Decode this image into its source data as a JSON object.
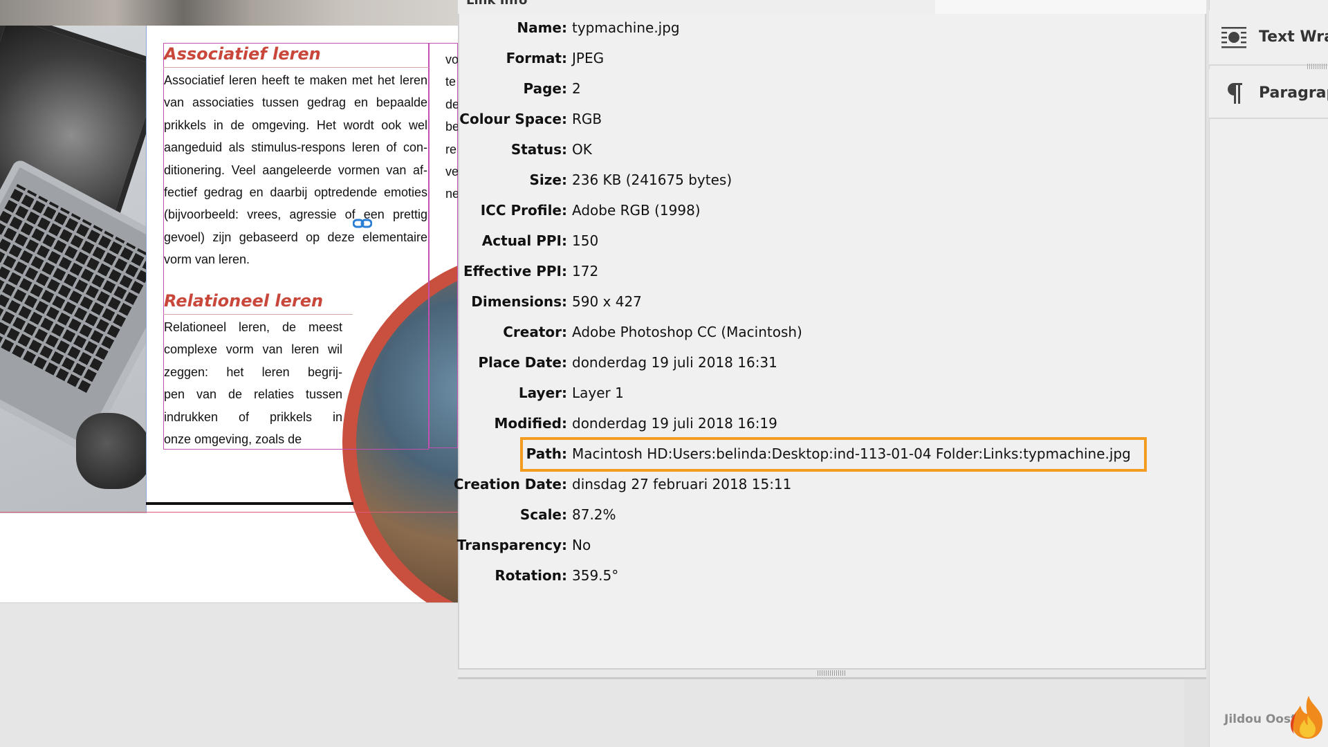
{
  "document": {
    "heading1": "Associatief leren",
    "para1_lines": [
      "Associatief leren heeft te maken met het leren",
      "van associaties tussen gedrag en bepaalde",
      "prikkels in de omgeving. Het wordt ook wel",
      "aangeduid als stimulus-respons leren of con-",
      "ditionering. Veel aangeleerde vormen van af-",
      "fectief gedrag en daarbij optredende emoties",
      "(bijvoorbeeld: vrees, agressie of een prettig",
      "gevoel) zijn gebaseerd op deze elementaire",
      "vorm van leren."
    ],
    "heading2": "Relationeel leren",
    "para2_lines": [
      "Relationeel leren, de meest",
      "complexe vorm van leren wil",
      "zeggen: het leren begrij-",
      "pen van de relaties tussen",
      "indrukken of prikkels in",
      "onze omgeving, zoals de"
    ],
    "col2_fragments": [
      "vo",
      "te",
      "de",
      "be",
      "re",
      "ve",
      "ne"
    ]
  },
  "link_info": {
    "title": "Link Info",
    "rows": [
      {
        "label": "Name:",
        "value": "typmachine.jpg"
      },
      {
        "label": "Format:",
        "value": "JPEG"
      },
      {
        "label": "Page:",
        "value": "2"
      },
      {
        "label": "Colour Space:",
        "value": "RGB"
      },
      {
        "label": "Status:",
        "value": "OK"
      },
      {
        "label": "Size:",
        "value": "236 KB (241675 bytes)"
      },
      {
        "label": "ICC Profile:",
        "value": "Adobe RGB (1998)"
      },
      {
        "label": "Actual PPI:",
        "value": "150"
      },
      {
        "label": "Effective PPI:",
        "value": "172"
      },
      {
        "label": "Dimensions:",
        "value": "590 x 427"
      },
      {
        "label": "Creator:",
        "value": "Adobe Photoshop CC (Macintosh)"
      },
      {
        "label": "Place Date:",
        "value": "donderdag 19 juli 2018 16:31"
      },
      {
        "label": "Layer:",
        "value": "Layer 1"
      },
      {
        "label": "Modified:",
        "value": "donderdag 19 juli 2018 16:19"
      },
      {
        "label": "Path:",
        "value": "Macintosh HD:Users:belinda:Desktop:ind-113-01-04 Folder:Links:typmachine.jpg"
      },
      {
        "label": "Creation Date:",
        "value": "dinsdag 27 februari 2018 15:11"
      },
      {
        "label": "Scale:",
        "value": "87.2%"
      },
      {
        "label": "Transparency:",
        "value": "No"
      },
      {
        "label": "Rotation:",
        "value": "359.5°"
      }
    ],
    "highlight_color": "#f39c1f"
  },
  "dock": {
    "text_wrap_label": "Text Wra",
    "paragraph_label": "Paragrap"
  },
  "watermark": "Jildou Oost",
  "colors": {
    "heading_red": "#c9473a",
    "frame_magenta": "#c34fb3",
    "panel_bg": "#f0f0f0"
  }
}
